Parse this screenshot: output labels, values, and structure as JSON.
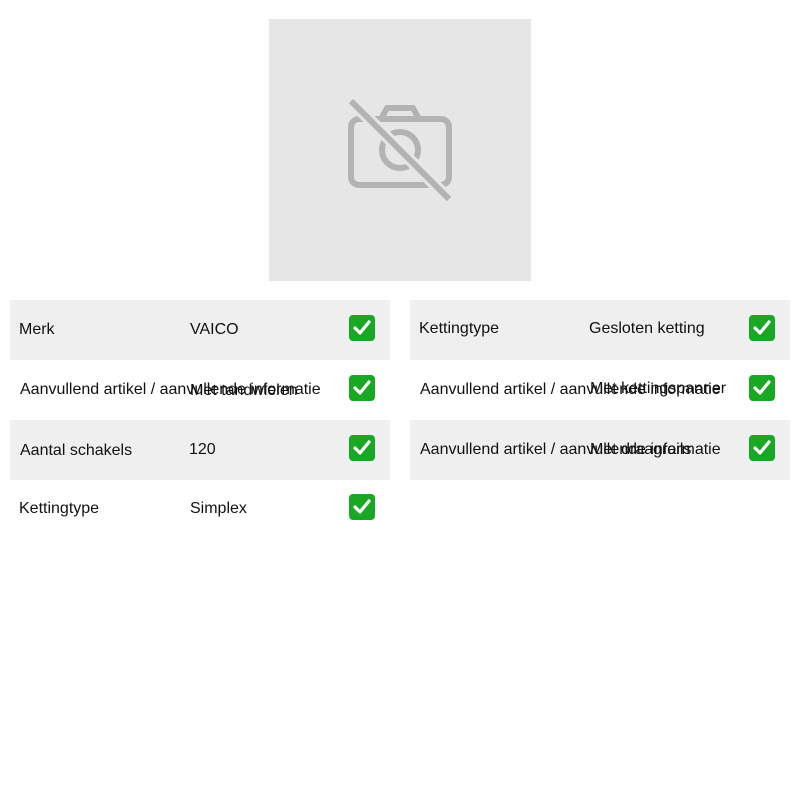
{
  "image": {
    "icon": "camera-off-icon",
    "background_color": "#e6e6e6"
  },
  "specs_left": [
    {
      "label": "Merk",
      "value": "VAICO",
      "check": "check-icon"
    },
    {
      "label": "Aanvullend artikel / aanvullende informatie",
      "value": "Met tandwielen",
      "check": "check-icon"
    },
    {
      "label": "Aantal schakels",
      "value": "120",
      "check": "check-icon"
    },
    {
      "label": "Kettingtype",
      "value": "Simplex",
      "check": "check-icon"
    }
  ],
  "specs_right": [
    {
      "label": "Kettingtype",
      "value": "Gesloten ketting",
      "check": "check-icon"
    },
    {
      "label": "Aanvullend artikel / aanvullende informatie",
      "value": "Met kettingspanner",
      "check": "check-icon"
    },
    {
      "label": "Aanvullend artikel / aanvullende informatie",
      "value": "Met draagrails",
      "check": "check-icon"
    }
  ],
  "colors": {
    "row_shade": "#efefef",
    "check_green": "#19a824",
    "placeholder": "#e6e6e6",
    "icon_gray": "#b3b3b3"
  }
}
